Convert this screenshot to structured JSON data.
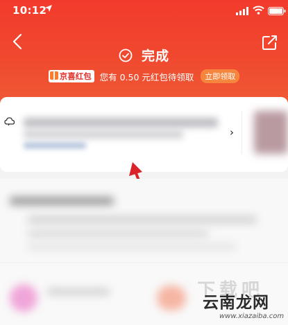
{
  "status_bar": {
    "time": "10:12"
  },
  "header": {
    "title": "完成",
    "promo_badge": "京喜红包",
    "promo_text": "您有 0.50 元红包待领取",
    "promo_button": "立即领取"
  },
  "order_card": {
    "chevron": "›"
  },
  "colors": {
    "header_red": "#f23a2c",
    "promo_orange": "#f6863e",
    "arrow": "#d9242a"
  },
  "watermark": {
    "text": "云南龙网",
    "ghost": "下载吧",
    "url": "www.xiazaiba.com"
  }
}
